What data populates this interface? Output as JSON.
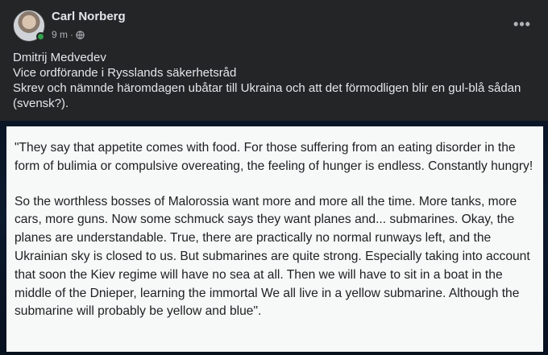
{
  "post": {
    "author": "Carl Norberg",
    "time": "9 m",
    "separator": "·",
    "privacy_icon": "globe-icon",
    "more_label": "•••",
    "text_lines": [
      "Dmitrij Medvedev",
      "Vice ordförande i Rysslands säkerhetsråd",
      "Skrev och nämnde häromdagen ubåtar till Ukraina och att det förmodligen blir en gul-blå sådan (svensk?)."
    ]
  },
  "quote": {
    "paragraph1": "\"They say that appetite comes with food. For those suffering from an eating disorder in the form of bulimia or compulsive overeating, the feeling of hunger is endless. Constantly hungry!",
    "paragraph2": "So the worthless bosses of Malorossia want more and more all the time. More tanks, more cars, more guns. Now some schmuck says they want planes and... submarines. Okay, the planes are understandable. True, there are practically no normal runways left, and the Ukrainian sky is closed to us. But submarines are quite strong. Especially taking into account that soon the Kiev regime will have no sea at all. Then we will have to sit in a boat in the middle of the Dnieper, learning the immortal We all live in a yellow submarine. Although the submarine will probably be yellow and blue\"."
  },
  "colors": {
    "background": "#242526",
    "text": "#e4e6eb",
    "secondary_text": "#b0b3b8",
    "online": "#31a24c"
  }
}
